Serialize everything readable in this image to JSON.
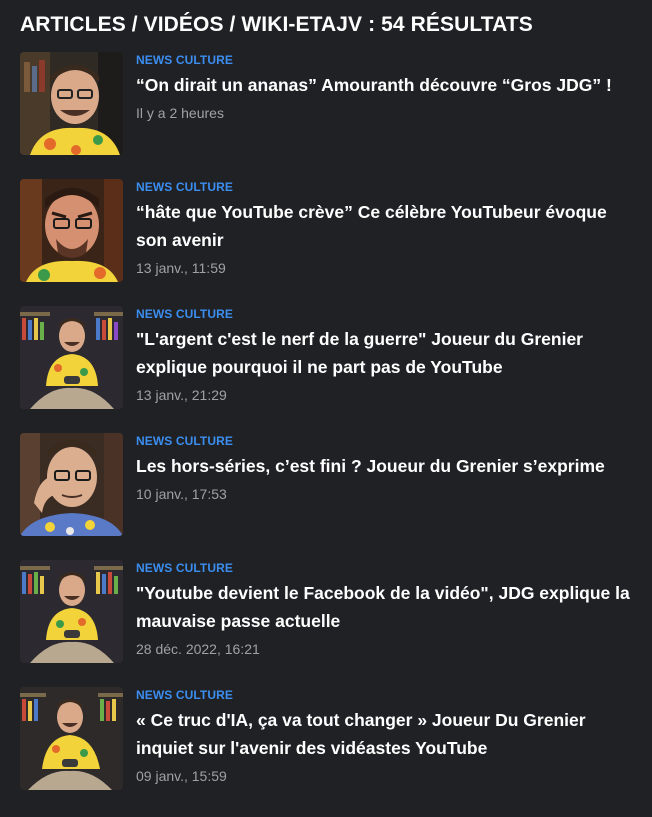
{
  "header": {
    "title": "ARTICLES / VIDÉOS / WIKI-ETAJV : 54 RÉSULTATS"
  },
  "articles": [
    {
      "category": "NEWS CULTURE",
      "title": "“On dirait un ananas” Amouranth découvre “Gros JDG” !",
      "date": "Il y a 2 heures",
      "thumbnail": "portrait-closeup-hawaiian-shirt"
    },
    {
      "category": "NEWS CULTURE",
      "title": "“hâte que YouTube crève” Ce célèbre YouTubeur évoque son avenir",
      "date": "13 janv., 11:59",
      "thumbnail": "portrait-angry-hawaiian-shirt"
    },
    {
      "category": "NEWS CULTURE",
      "title": "\"L'argent c'est le nerf de la guerre\" Joueur du Grenier explique pourquoi il ne part pas de YouTube",
      "date": "13 janv., 21:29",
      "thumbnail": "seated-with-controller"
    },
    {
      "category": "NEWS CULTURE",
      "title": "Les hors-séries, c’est fini ? Joueur du Grenier s’exprime",
      "date": "10 janv., 17:53",
      "thumbnail": "portrait-hand-on-face"
    },
    {
      "category": "NEWS CULTURE",
      "title": "\"Youtube devient le Facebook de la vidéo\", JDG explique la mauvaise passe actuelle",
      "date": "28 déc. 2022, 16:21",
      "thumbnail": "seated-with-controller"
    },
    {
      "category": "NEWS CULTURE",
      "title": "« Ce truc d'IA, ça va tout changer » Joueur Du Grenier inquiet sur l'avenir des vidéastes YouTube",
      "date": "09 janv., 15:59",
      "thumbnail": "seated-with-controller"
    }
  ],
  "colors": {
    "background": "#202125",
    "category": "#3b8ef0",
    "title": "#ffffff",
    "date": "#a0a0a5",
    "shirt": "#f2d33a"
  }
}
